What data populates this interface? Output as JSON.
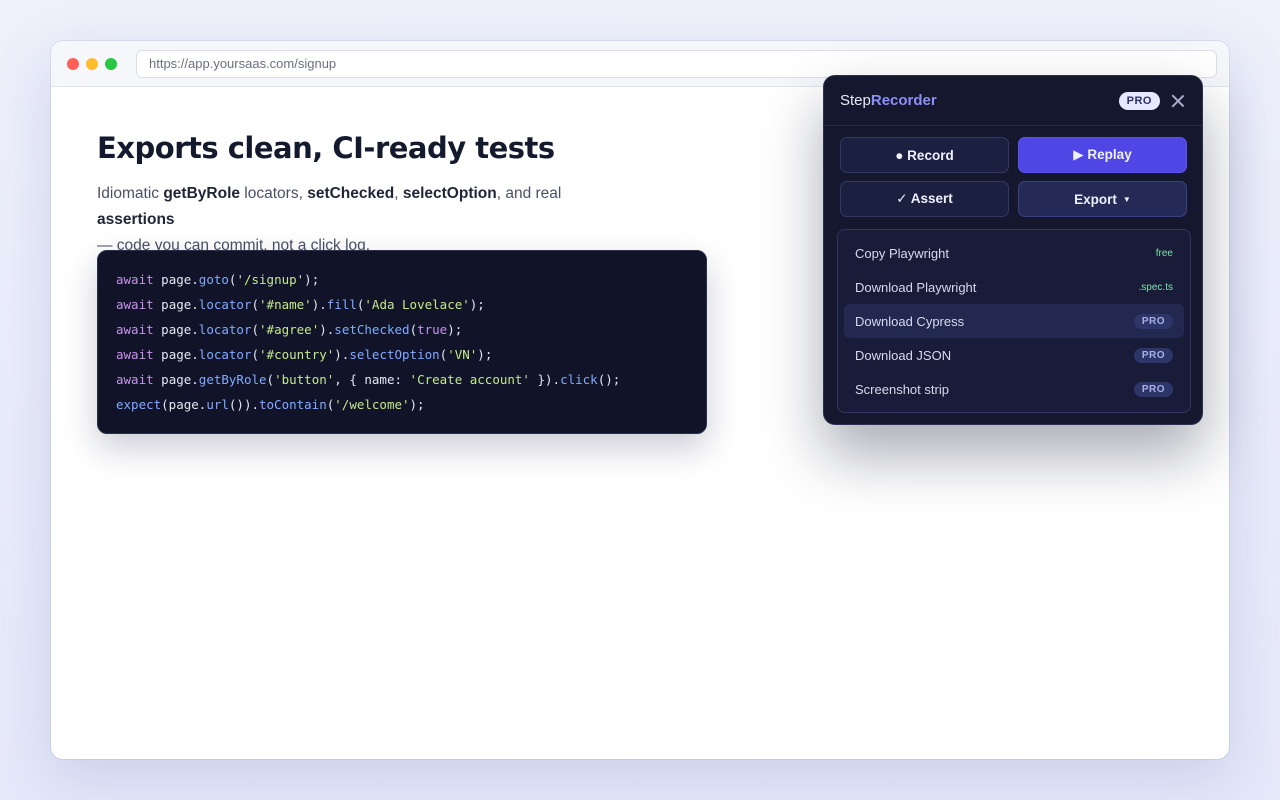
{
  "browser": {
    "url": "https://app.yoursaas.com/signup"
  },
  "hero": {
    "headline": "Exports clean, CI-ready tests",
    "sub": {
      "t1": "Idiomatic ",
      "b1": "getByRole",
      "t2": " locators, ",
      "b2": "setChecked",
      "t3": ", ",
      "b3": "selectOption",
      "t4": ", and real ",
      "b4": "assertions",
      "t5": "— code you can commit, not a click log."
    }
  },
  "code": {
    "lines": [
      [
        "await",
        " page.",
        "goto",
        "(",
        "'/signup'",
        ");"
      ],
      [
        "await",
        " page.",
        "locator",
        "(",
        "'#name'",
        ").",
        "fill",
        "(",
        "'Ada Lovelace'",
        ");"
      ],
      [
        "await",
        " page.",
        "locator",
        "(",
        "'#agree'",
        ").",
        "setChecked",
        "(",
        "true",
        ");"
      ],
      [
        "await",
        " page.",
        "locator",
        "(",
        "'#country'",
        ").",
        "selectOption",
        "(",
        "'VN'",
        ");"
      ],
      [
        "await",
        " page.",
        "getByRole",
        "(",
        "'button'",
        ", { name: ",
        "'Create account'",
        " }).",
        "click",
        "();"
      ],
      [
        "expect",
        "(page.",
        "url",
        "()).",
        "toContain",
        "(",
        "'/welcome'",
        ");"
      ]
    ]
  },
  "panel": {
    "brand_plain": "Step",
    "brand_accent": "Recorder",
    "pro_badge": "PRO",
    "buttons": {
      "record": "● Record",
      "replay": "▶ Replay",
      "assert": "✓ Assert",
      "export": "Export",
      "export_caret": "▼"
    },
    "menu": [
      {
        "label": "Copy Playwright",
        "badge": "free"
      },
      {
        "label": "Download Playwright",
        "badge": ".spec.ts"
      },
      {
        "label": "Download Cypress",
        "badge": "PRO"
      },
      {
        "label": "Download JSON",
        "badge": "PRO"
      },
      {
        "label": "Screenshot strip",
        "badge": "PRO"
      }
    ]
  },
  "colors": {
    "accent": "#5046e5",
    "brand_accent": "#8b8ff8",
    "panel_bg": "#14172d",
    "code_bg": "#111428"
  }
}
